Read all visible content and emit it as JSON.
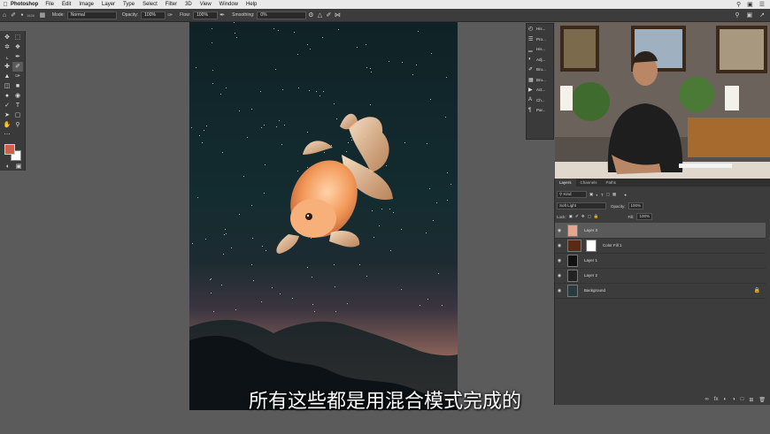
{
  "menubar": {
    "apple": "",
    "app": "Photoshop",
    "items": [
      "File",
      "Edit",
      "Image",
      "Layer",
      "Type",
      "Select",
      "Filter",
      "3D",
      "View",
      "Window",
      "Help"
    ]
  },
  "options": {
    "mode_label": "Mode:",
    "mode_value": "Normal",
    "opacity_label": "Opacity:",
    "opacity_value": "100%",
    "flow_label": "Flow:",
    "flow_value": "100%",
    "smoothing_label": "Smoothing:",
    "smoothing_value": "0%",
    "brush_size": "1628"
  },
  "mini_panels": [
    "His...",
    "Pro...",
    "His...",
    "Adj...",
    "Bru...",
    "Bru...",
    "Act...",
    "Ch...",
    "Par..."
  ],
  "layers_panel": {
    "tabs": [
      "Layers",
      "Channels",
      "Paths"
    ],
    "kind_label": "Kind",
    "blend_mode": "Soft Light",
    "opacity_label": "Opacity:",
    "opacity_value": "100%",
    "lock_label": "Lock:",
    "fill_label": "Fill:",
    "fill_value": "100%",
    "layers": [
      {
        "name": "Layer 3",
        "selected": true,
        "thumb": "#e7a58d"
      },
      {
        "name": "Color Fill 1",
        "selected": false,
        "thumb": "#5a2a14"
      },
      {
        "name": "Layer 1",
        "selected": false,
        "thumb": "#111111"
      },
      {
        "name": "Layer 2",
        "selected": false,
        "thumb": "#222222"
      },
      {
        "name": "Background",
        "selected": false,
        "thumb": "#2a3b3f"
      }
    ]
  },
  "subtitle": "所有这些都是用混合模式完成的",
  "colors": {
    "foreground": "#d0604a",
    "background": "#ffffff"
  }
}
